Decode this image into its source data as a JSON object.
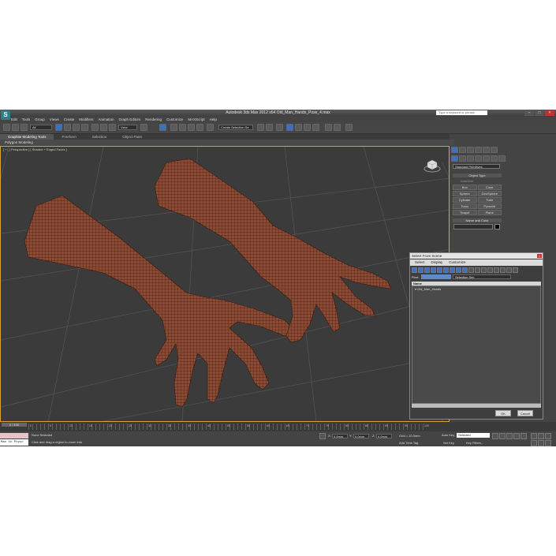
{
  "app": {
    "title": "Autodesk 3ds Max 2012 x64      Old_Man_Hands_Pose_4.max",
    "search_placeholder": "Type a keyword or phrase",
    "logo_letter": "S"
  },
  "menubar": [
    "Edit",
    "Tools",
    "Group",
    "Views",
    "Create",
    "Modifiers",
    "Animation",
    "Graph Editors",
    "Rendering",
    "Customize",
    "MAXScript",
    "Help"
  ],
  "toolbar": {
    "filter_value": "All",
    "view_value": "View",
    "selection_set_placeholder": "Create Selection Se"
  },
  "ribbon": {
    "tabs": [
      "Graphite Modeling Tools",
      "Freeform",
      "Selection",
      "Object Paint"
    ],
    "active_tab": "Graphite Modeling Tools",
    "panel_label": "Polygon Modeling"
  },
  "viewport": {
    "label": "[ + ] [ Perspective ] [ Shaded + Edged Faces ]"
  },
  "command_panel": {
    "dropdown_value": "Standard Primitives",
    "object_type_header": "Object Type",
    "autogrid_label": "AutoGrid",
    "primitives": [
      "Box",
      "Cone",
      "Sphere",
      "GeoSphere",
      "Cylinder",
      "Tube",
      "Torus",
      "Pyramid",
      "Teapot",
      "Plane"
    ],
    "name_color_header": "Name and Color"
  },
  "select_dialog": {
    "title": "Select From Scene",
    "menu": [
      "Select",
      "Display",
      "Customize"
    ],
    "find_label": "Find:",
    "selection_set_label": "Selection Set:",
    "column_name": "Name",
    "items": [
      "Old_Man_Hands"
    ],
    "ok_label": "OK",
    "cancel_label": "Cancel"
  },
  "timeline": {
    "slider_label": "0 / 100",
    "tick_labels": [
      "0",
      "5",
      "10",
      "15",
      "20",
      "25",
      "30",
      "35",
      "40",
      "45",
      "50",
      "55",
      "60",
      "65",
      "70",
      "75",
      "80",
      "85",
      "90",
      "95",
      "100"
    ]
  },
  "status": {
    "maxscript_label": "Max to Physc",
    "selection_status": "None Selected",
    "prompt": "Click and drag a region to zoom into",
    "x_label": "X:",
    "x_value": "0.0mm",
    "y_label": "Y:",
    "y_value": "0.0mm",
    "z_label": "Z:",
    "z_value": "0.0mm",
    "grid_label": "Grid = 10.0mm",
    "add_time_tag": "Add Time Tag",
    "auto_key": "Auto Key",
    "set_key": "Set Key",
    "selected_value": "Selected",
    "key_filters": "Key Filters..."
  }
}
